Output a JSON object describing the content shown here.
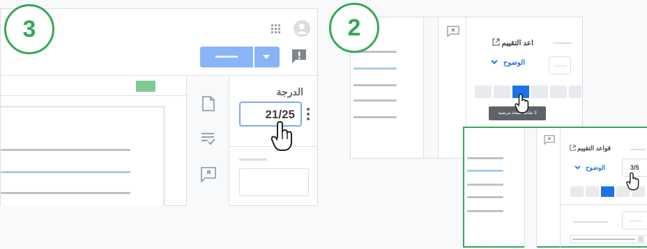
{
  "badges": {
    "left_step": "3",
    "right_step": "2"
  },
  "left_screen": {
    "grade_label": "الدرجة",
    "grade_value": "21/25",
    "icons": [
      "apps-icon",
      "account-icon",
      "feedback-icon",
      "file-icon",
      "rubric-icon",
      "comment-icon",
      "more-vert-icon"
    ]
  },
  "middle_screen": {
    "rubric_link": "اعد التقييم",
    "criterion": "الوضوح",
    "tooltip": "3 نقاط: نتيجة مرضية"
  },
  "front_screen": {
    "rubric_link": "قواعد التقييم",
    "criterion": "الوضوح",
    "score": "3/5"
  },
  "colors": {
    "accent_green": "#34a853",
    "accent_blue": "#1a73e8",
    "button_blue": "#8ab4f8"
  }
}
